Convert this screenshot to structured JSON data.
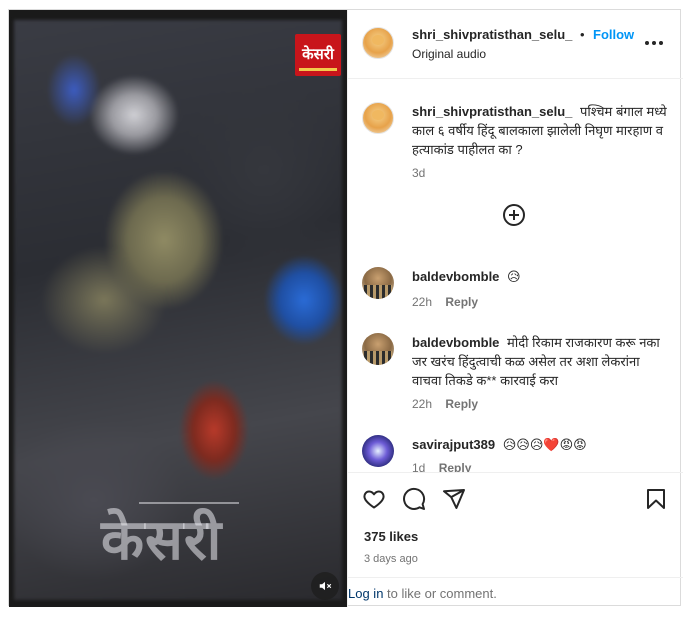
{
  "media": {
    "logo_text": "केसरी",
    "watermark_text": "केसरी",
    "mute_icon": "speaker-muted-icon"
  },
  "header": {
    "username": "shri_shivpratisthan_selu_",
    "separator": "•",
    "follow_label": "Follow",
    "subtitle": "Original audio",
    "more_icon": "more-horizontal-icon"
  },
  "caption": {
    "username": "shri_shivpratisthan_selu_",
    "text": "पश्चिम बंगाल मध्ये काल ६ वर्षीय हिंदू बालकाला झालेली निघृण मारहाण व हत्याकांड पाहीलत का ?",
    "time": "3d"
  },
  "load_more_icon": "plus-circle-icon",
  "comments": [
    {
      "username": "baldevbomble",
      "text": "😥",
      "time": "22h",
      "reply_label": "Reply"
    },
    {
      "username": "baldevbomble",
      "text": "मोदी रिकाम राजकारण करू नका जर खरंच हिंदुत्वाची कळ असेल तर अशा लेकरांना वाचवा तिकडे क** कारवाई करा",
      "time": "22h",
      "reply_label": "Reply"
    },
    {
      "username": "savirajput389",
      "text": "😥😥😥❤️😡😡",
      "time": "1d",
      "reply_label": "Reply"
    }
  ],
  "actions": {
    "like_icon": "heart-icon",
    "comment_icon": "comment-icon",
    "share_icon": "share-icon",
    "save_icon": "bookmark-icon",
    "likes": "375 likes",
    "ago": "3 days ago"
  },
  "login_bar": {
    "link": "Log in",
    "text": " to like or comment."
  },
  "colors": {
    "accent": "#0095f6",
    "border": "#dbdbdb",
    "muted": "#737373",
    "text": "#262626"
  }
}
